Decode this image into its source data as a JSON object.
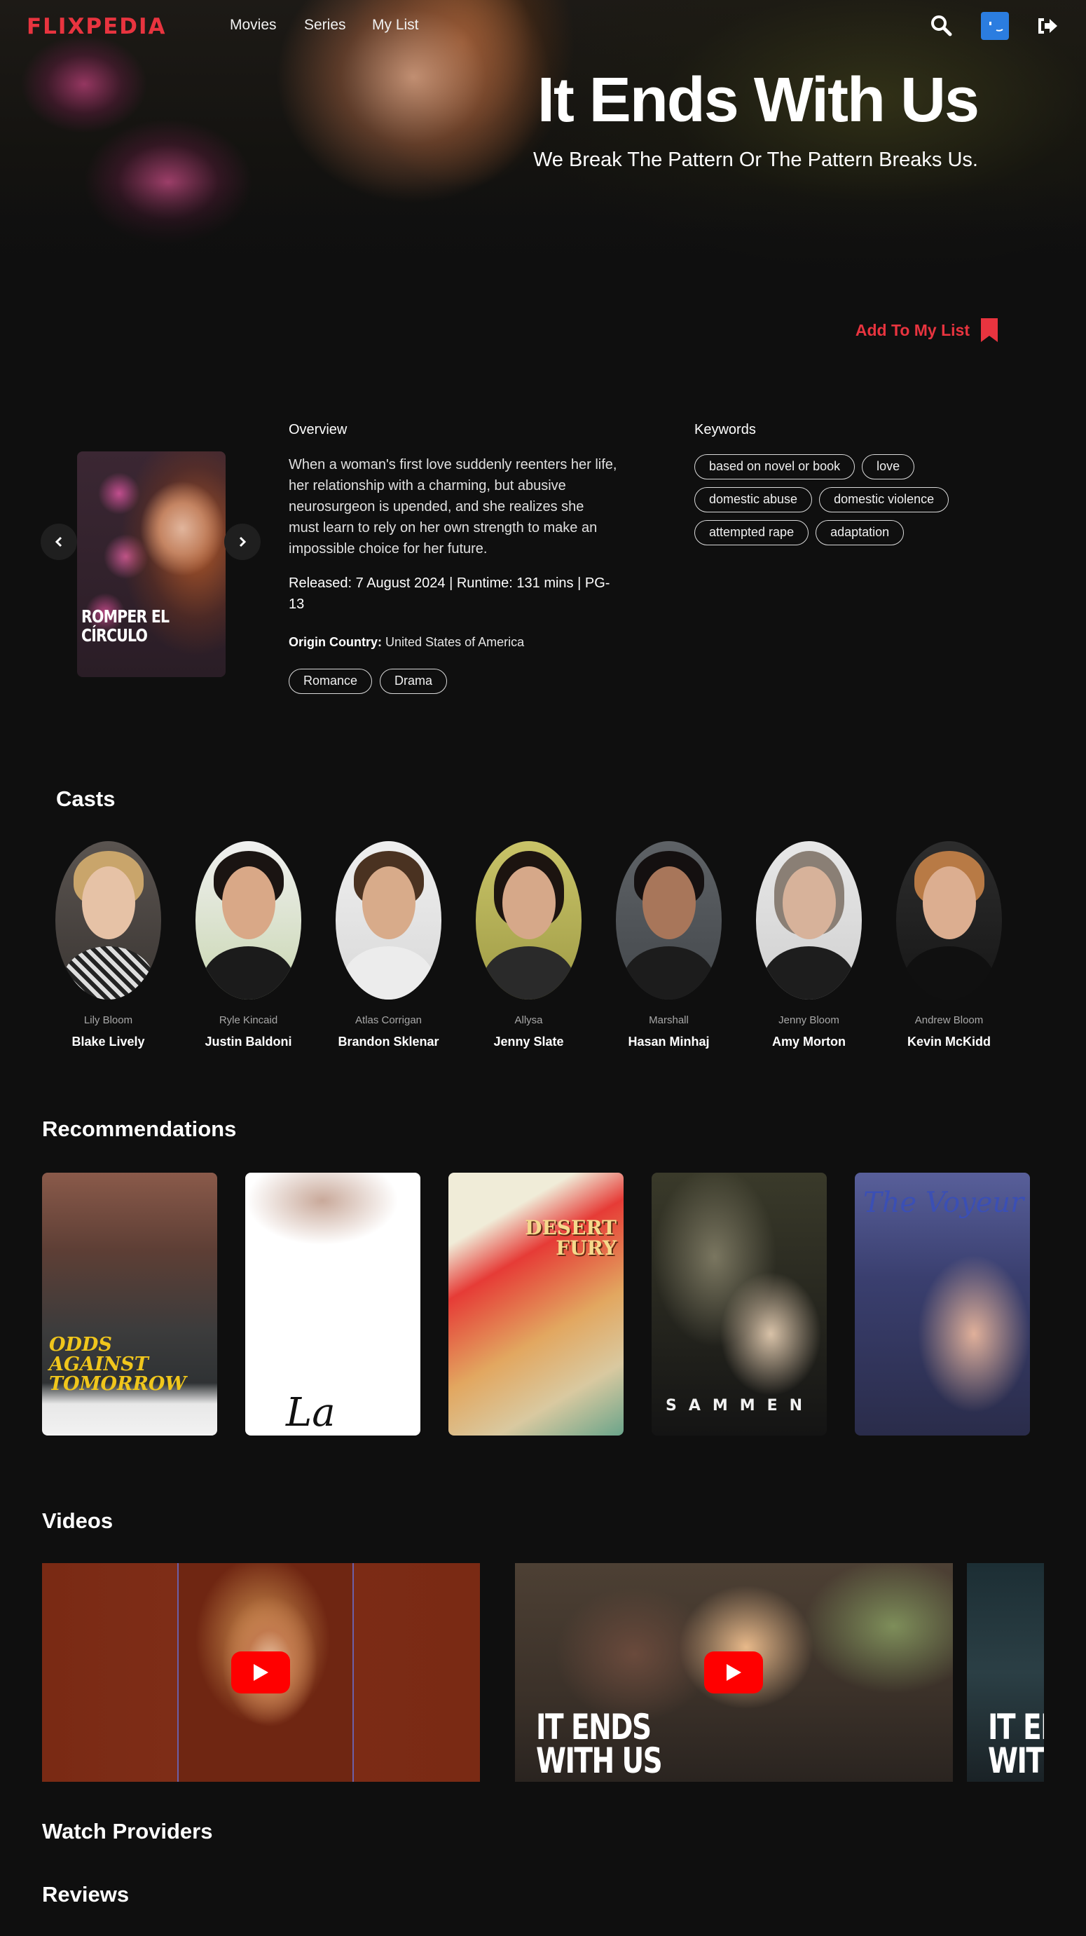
{
  "nav": {
    "logo": "FLIXPEDIA",
    "links": [
      "Movies",
      "Series",
      "My List"
    ],
    "icons": [
      "search-icon",
      "avatar",
      "logout-icon"
    ]
  },
  "movie": {
    "title": "It Ends With Us",
    "tagline": "We Break The Pattern Or The Pattern Breaks Us.",
    "add_to_list_label": "Add To My List",
    "poster_text": "ROMPER EL CÍRCULO",
    "overview_label": "Overview",
    "overview": "When a woman's first love suddenly reenters her life, her relationship with a charming, but abusive neurosurgeon is upended, and she realizes she must learn to rely on her own strength to make an impossible choice for her future.",
    "release_line": "Released: 7 August 2024 | Runtime: 131 mins | PG-13",
    "origin_label": "Origin Country:",
    "origin_value": "United States of America",
    "genres": [
      "Romance",
      "Drama"
    ],
    "keywords_label": "Keywords",
    "keywords": [
      "based on novel or book",
      "love",
      "domestic abuse",
      "domestic violence",
      "attempted rape",
      "adaptation"
    ]
  },
  "casts": {
    "heading": "Casts",
    "items": [
      {
        "role": "Lily Bloom",
        "name": "Blake Lively"
      },
      {
        "role": "Ryle Kincaid",
        "name": "Justin Baldoni"
      },
      {
        "role": "Atlas Corrigan",
        "name": "Brandon Sklenar"
      },
      {
        "role": "Allysa",
        "name": "Jenny Slate"
      },
      {
        "role": "Marshall",
        "name": "Hasan Minhaj"
      },
      {
        "role": "Jenny Bloom",
        "name": "Amy Morton"
      },
      {
        "role": "Andrew Bloom",
        "name": "Kevin McKidd"
      }
    ]
  },
  "recommendations": {
    "heading": "Recommendations",
    "items": [
      "Odds Against Tomorrow",
      "La Belle",
      "Desert Fury",
      "SAMMEN",
      "The Voyeur"
    ]
  },
  "videos": {
    "heading": "Videos",
    "items": [
      {
        "overlay_text": ""
      },
      {
        "overlay_text": "IT ENDS WITH US"
      },
      {
        "overlay_text": "IT ENDS WITH US"
      }
    ]
  },
  "watch_providers": {
    "heading": "Watch Providers"
  },
  "reviews": {
    "heading": "Reviews"
  },
  "colors": {
    "accent": "#e8343f",
    "background": "#0f0f0f",
    "play_button": "#ff0000",
    "avatar": "#2b7de0"
  }
}
